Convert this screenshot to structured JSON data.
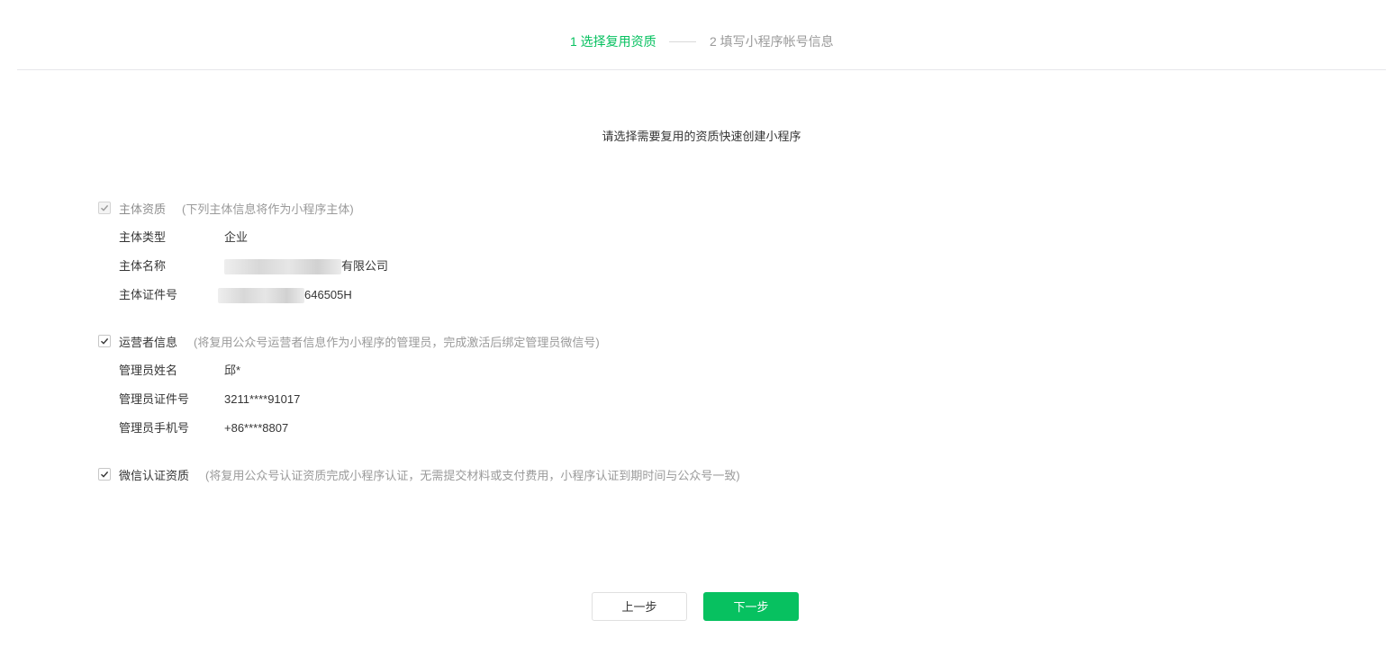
{
  "steps": [
    {
      "label": "1 选择复用资质",
      "active": true
    },
    {
      "label": "2 填写小程序帐号信息",
      "active": false
    }
  ],
  "intro": "请选择需要复用的资质快速创建小程序",
  "sections": {
    "entity": {
      "title": "主体资质",
      "note": "(下列主体信息将作为小程序主体)",
      "checked": true,
      "disabled": true,
      "rows": [
        {
          "label": "主体类型",
          "value": "企业"
        },
        {
          "label": "主体名称",
          "value_prefix": "",
          "value_suffix": "有限公司"
        },
        {
          "label": "主体证件号",
          "value_prefix": "",
          "value_suffix": "646505H"
        }
      ]
    },
    "operator": {
      "title": "运营者信息",
      "note": "(将复用公众号运营者信息作为小程序的管理员，完成激活后绑定管理员微信号)",
      "checked": true,
      "disabled": false,
      "rows": [
        {
          "label": "管理员姓名",
          "value": "邱*"
        },
        {
          "label": "管理员证件号",
          "value": "3211****91017"
        },
        {
          "label": "管理员手机号",
          "value": "+86****8807"
        }
      ]
    },
    "certification": {
      "title": "微信认证资质",
      "note": "(将复用公众号认证资质完成小程序认证，无需提交材料或支付费用，小程序认证到期时间与公众号一致)",
      "checked": true,
      "disabled": false
    }
  },
  "buttons": {
    "prev": "上一步",
    "next": "下一步"
  },
  "colors": {
    "accent": "#07c160",
    "muted": "#9a9a9a"
  }
}
